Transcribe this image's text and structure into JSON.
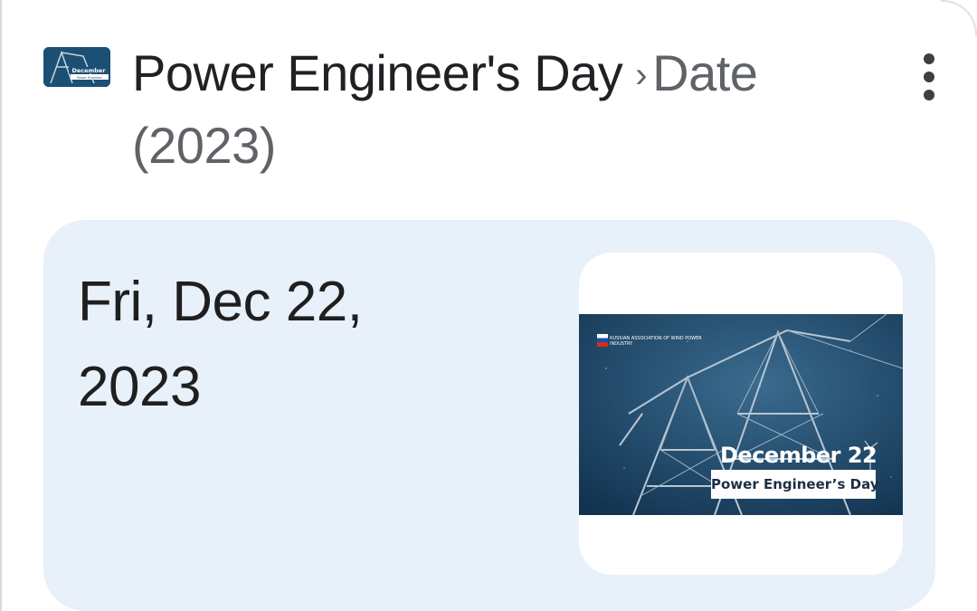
{
  "header": {
    "favicon_icon": "site-favicon-transmission-tower",
    "breadcrumb_main": "Power Engineer's Day",
    "breadcrumb_separator": "›",
    "breadcrumb_sub": "Date",
    "breadcrumb_year": "(2023)",
    "more_icon": "more-vert-icon"
  },
  "answer_card": {
    "date_line1": "Fri, Dec 22,",
    "date_line2": "2023",
    "thumbnail": {
      "org_text": "Russian Association of Wind Power Industry",
      "date_text": "December 22",
      "banner_text": "Power Engineer’s Day"
    }
  },
  "colors": {
    "card_background": "#e8f0fa",
    "thumbnail_background": "#1c4f74",
    "title_text": "#202124",
    "secondary_text": "#5f6368"
  }
}
